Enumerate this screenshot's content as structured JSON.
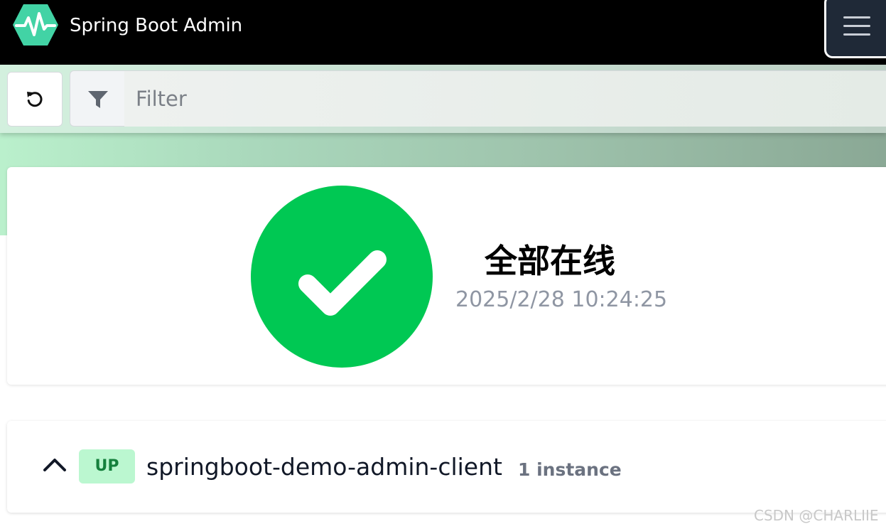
{
  "header": {
    "title": "Spring Boot Admin",
    "logo_icon": "heartbeat-hexagon-icon",
    "logo_color": "#42d3a5",
    "menu_icon": "hamburger-menu-icon"
  },
  "toolbar": {
    "refresh_icon": "refresh-icon",
    "filter_icon": "filter-icon",
    "filter_placeholder": "Filter",
    "filter_value": ""
  },
  "status": {
    "icon": "check-circle-icon",
    "icon_color": "#00c853",
    "title": "全部在线",
    "timestamp": "2025/2/28 10:24:25"
  },
  "applications": [
    {
      "toggle_icon": "chevron-up-icon",
      "status": "UP",
      "status_color": "#bbf7d0",
      "name": "springboot-demo-admin-client",
      "instances": "1 instance"
    }
  ],
  "watermark": "CSDN @CHARLIIE"
}
